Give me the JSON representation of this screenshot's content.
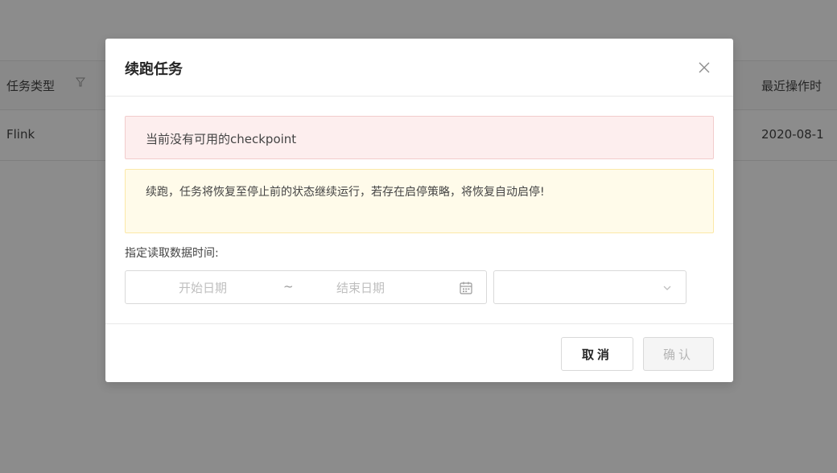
{
  "background_table": {
    "header": {
      "task_type": "任务类型",
      "last_operation_time": "最近操作时"
    },
    "rows": [
      {
        "task_type": "Flink",
        "last_operation_time": "2020-08-1"
      }
    ]
  },
  "modal": {
    "title": "续跑任务",
    "error_alert": "当前没有可用的checkpoint",
    "warning_alert": "续跑，任务将恢复至停止前的状态继续运行，若存在启停策略，将恢复自动启停!",
    "read_time_label": "指定读取数据时间:",
    "date_range": {
      "start_placeholder": "开始日期",
      "separator": "~",
      "end_placeholder": "结束日期"
    },
    "time_select": {
      "value": ""
    },
    "buttons": {
      "cancel": "取消",
      "ok": "确认"
    }
  },
  "icons": {
    "filter": "filter-icon",
    "close": "close-icon",
    "calendar": "calendar-icon",
    "dropdown": "chevron-down-icon"
  }
}
